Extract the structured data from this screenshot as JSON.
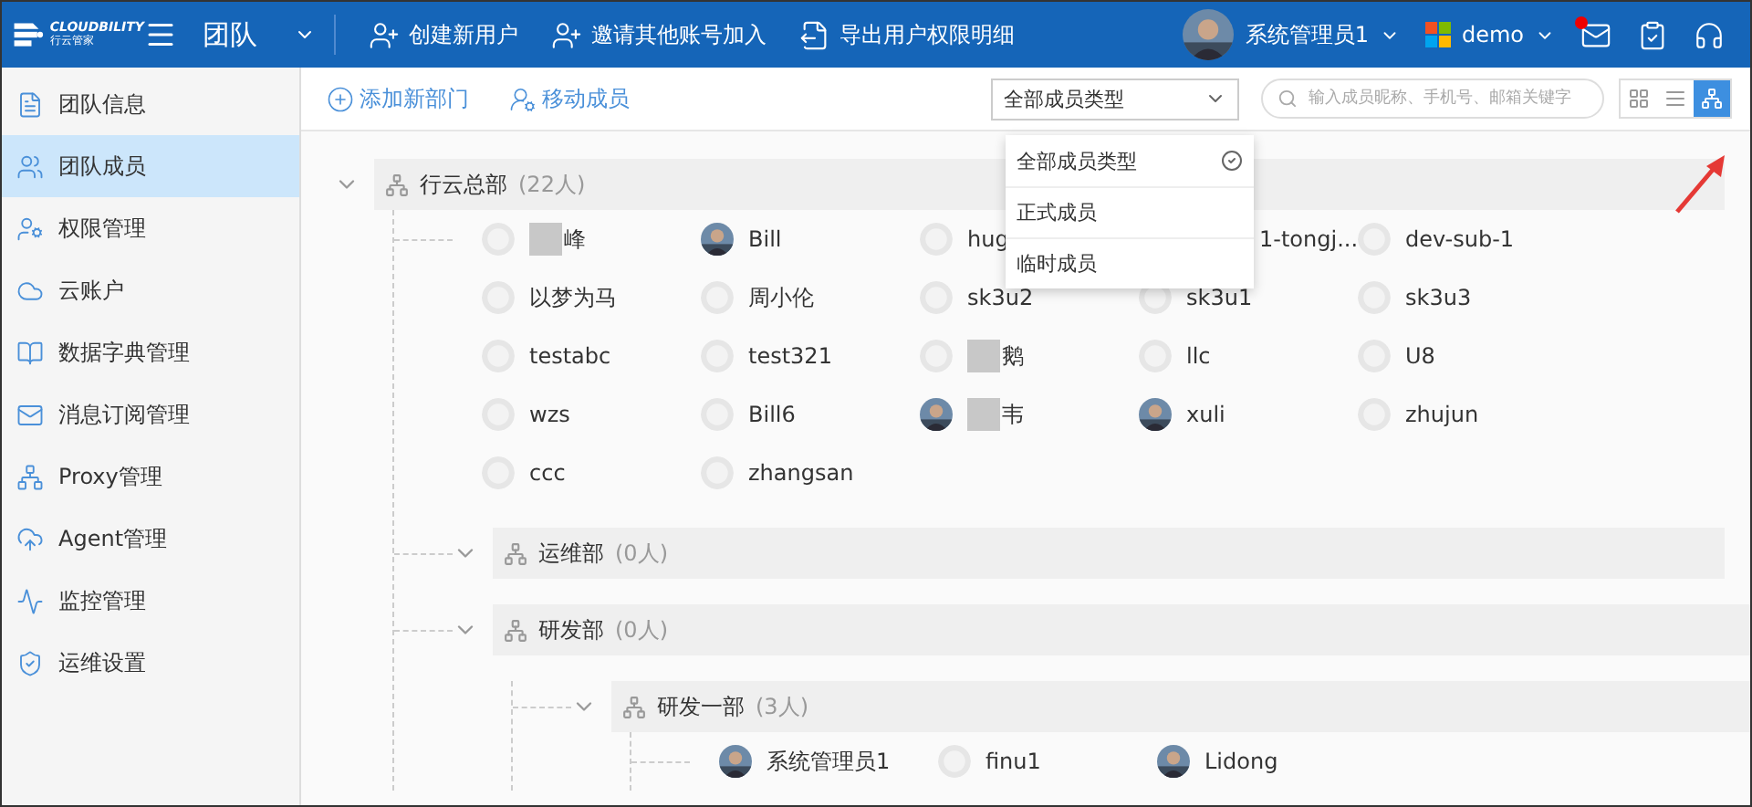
{
  "header": {
    "logo_text": "CLOUDBILITY",
    "logo_subtext": "行云管家",
    "module": "团队",
    "actions": [
      {
        "kind": "user-plus",
        "label": "创建新用户"
      },
      {
        "kind": "user-plus",
        "label": "邀请其他账号加入"
      },
      {
        "kind": "export",
        "label": "导出用户权限明细"
      }
    ],
    "user": "系统管理员1",
    "tenant": "demo",
    "mail_unread": true
  },
  "sidebar": {
    "items": [
      {
        "kind": "info",
        "label": "团队信息",
        "selected": false
      },
      {
        "kind": "users",
        "label": "团队成员",
        "selected": true
      },
      {
        "kind": "user-gear",
        "label": "权限管理",
        "selected": false
      },
      {
        "kind": "cloud",
        "label": "云账户",
        "selected": false
      },
      {
        "kind": "book",
        "label": "数据字典管理",
        "selected": false
      },
      {
        "kind": "mail",
        "label": "消息订阅管理",
        "selected": false
      },
      {
        "kind": "org",
        "label": "Proxy管理",
        "selected": false
      },
      {
        "kind": "agent",
        "label": "Agent管理",
        "selected": false
      },
      {
        "kind": "monitor",
        "label": "监控管理",
        "selected": false
      },
      {
        "kind": "shield",
        "label": "运维设置",
        "selected": false
      }
    ]
  },
  "toolbar": {
    "add_department": "添加新部门",
    "move_members": "移动成员",
    "filter": "全部成员类型",
    "search": {
      "placeholder": "输入成员昵称、手机号、邮箱关键字"
    },
    "views": [
      {
        "kind": "grid",
        "selected": false
      },
      {
        "kind": "list",
        "selected": false
      },
      {
        "kind": "tree",
        "selected": true
      }
    ]
  },
  "filter_menu": {
    "options": [
      {
        "label": "全部成员类型",
        "selected": true
      },
      {
        "label": "正式成员",
        "selected": false
      },
      {
        "label": "临时成员",
        "selected": false
      }
    ]
  },
  "tree": [
    {
      "name": "行云总部",
      "count": "(22人)",
      "expanded": true,
      "members": [
        {
          "name": "峰",
          "kind": "default",
          "redacted": true
        },
        {
          "name": "Bill",
          "redacted": false
        },
        {
          "name": "hug",
          "kind": "default",
          "redacted": false
        },
        {
          "name": "1-tongj...",
          "kind": "covered",
          "redacted": false
        },
        {
          "name": "dev-sub-1",
          "kind": "default",
          "redacted": false
        },
        {
          "name": "以梦为马",
          "kind": "default",
          "redacted": false
        },
        {
          "name": "周小伦",
          "kind": "default",
          "redacted": false
        },
        {
          "name": "sk3u2",
          "kind": "default",
          "redacted": false
        },
        {
          "name": "sk3u1",
          "kind": "default",
          "redacted": false
        },
        {
          "name": "sk3u3",
          "kind": "default",
          "redacted": false
        },
        {
          "name": "testabc",
          "kind": "default",
          "redacted": false
        },
        {
          "name": "test321",
          "kind": "default",
          "redacted": false
        },
        {
          "name": "鹅",
          "kind": "default",
          "redacted": true
        },
        {
          "name": "llc",
          "kind": "default",
          "redacted": false
        },
        {
          "name": "U8",
          "kind": "default",
          "redacted": false
        },
        {
          "name": "wzs",
          "kind": "default",
          "redacted": false
        },
        {
          "name": "Bill6",
          "kind": "default",
          "redacted": false
        },
        {
          "name": "韦",
          "redacted": true
        },
        {
          "name": "xuli",
          "redacted": false
        },
        {
          "name": "zhujun",
          "kind": "default",
          "redacted": false
        },
        {
          "name": "ccc",
          "kind": "default",
          "redacted": false
        },
        {
          "name": "zhangsan",
          "kind": "default",
          "redacted": false
        }
      ],
      "children": [
        {
          "name": "运维部",
          "count": "(0人)",
          "expanded": true
        },
        {
          "name": "研发部",
          "count": "(0人)",
          "expanded": true,
          "children": [
            {
              "name": "研发一部",
              "count": "(3人)",
              "expanded": true,
              "members": [
                {
                  "name": "系统管理员1",
                  "redacted": false
                },
                {
                  "name": "finu1",
                  "kind": "default",
                  "redacted": false
                },
                {
                  "name": "Lidong",
                  "redacted": false
                }
              ]
            }
          ]
        }
      ]
    }
  ]
}
